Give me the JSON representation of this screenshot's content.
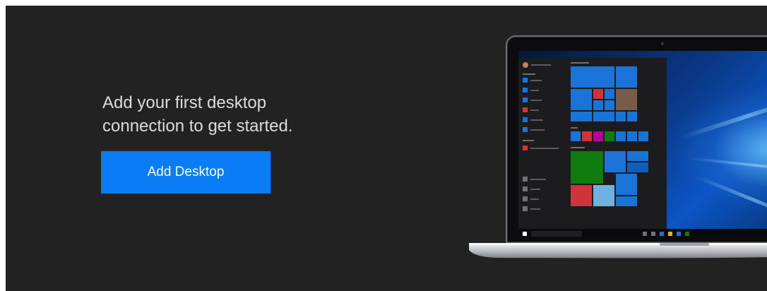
{
  "empty_state": {
    "message_line1": "Add your first desktop",
    "message_line2": "connection to get started.",
    "add_button_label": "Add Desktop"
  },
  "colors": {
    "panel_background": "#222222",
    "accent_button": "#0a7cf5",
    "message_text": "#dcdcdc"
  },
  "illustration": {
    "icon": "laptop-windows-illustration"
  }
}
